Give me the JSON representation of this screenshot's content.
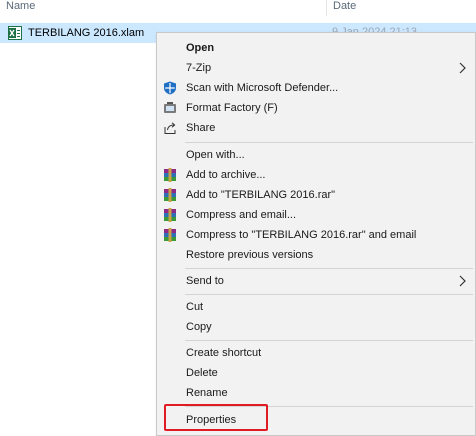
{
  "header": {
    "name_col": "Name",
    "date_col": "Date"
  },
  "file": {
    "name": "TERBILANG 2016.xlam",
    "date": "9 Jan 2024 21:13",
    "icon": "excel-addin-icon"
  },
  "menu": {
    "open": "Open",
    "zip": "7-Zip",
    "defender": "Scan with Microsoft Defender...",
    "format_factory": "Format Factory (F)",
    "share": "Share",
    "open_with": "Open with...",
    "add_archive": "Add to archive...",
    "add_rar": "Add to \"TERBILANG 2016.rar\"",
    "compress_email": "Compress and email...",
    "compress_rar_email": "Compress to \"TERBILANG 2016.rar\" and email",
    "restore": "Restore previous versions",
    "send_to": "Send to",
    "cut": "Cut",
    "copy": "Copy",
    "create_shortcut": "Create shortcut",
    "delete": "Delete",
    "rename": "Rename",
    "properties": "Properties"
  },
  "colors": {
    "selection": "#cce8ff",
    "menu_bg": "#f2f2f2",
    "highlight": "#e01b24"
  }
}
